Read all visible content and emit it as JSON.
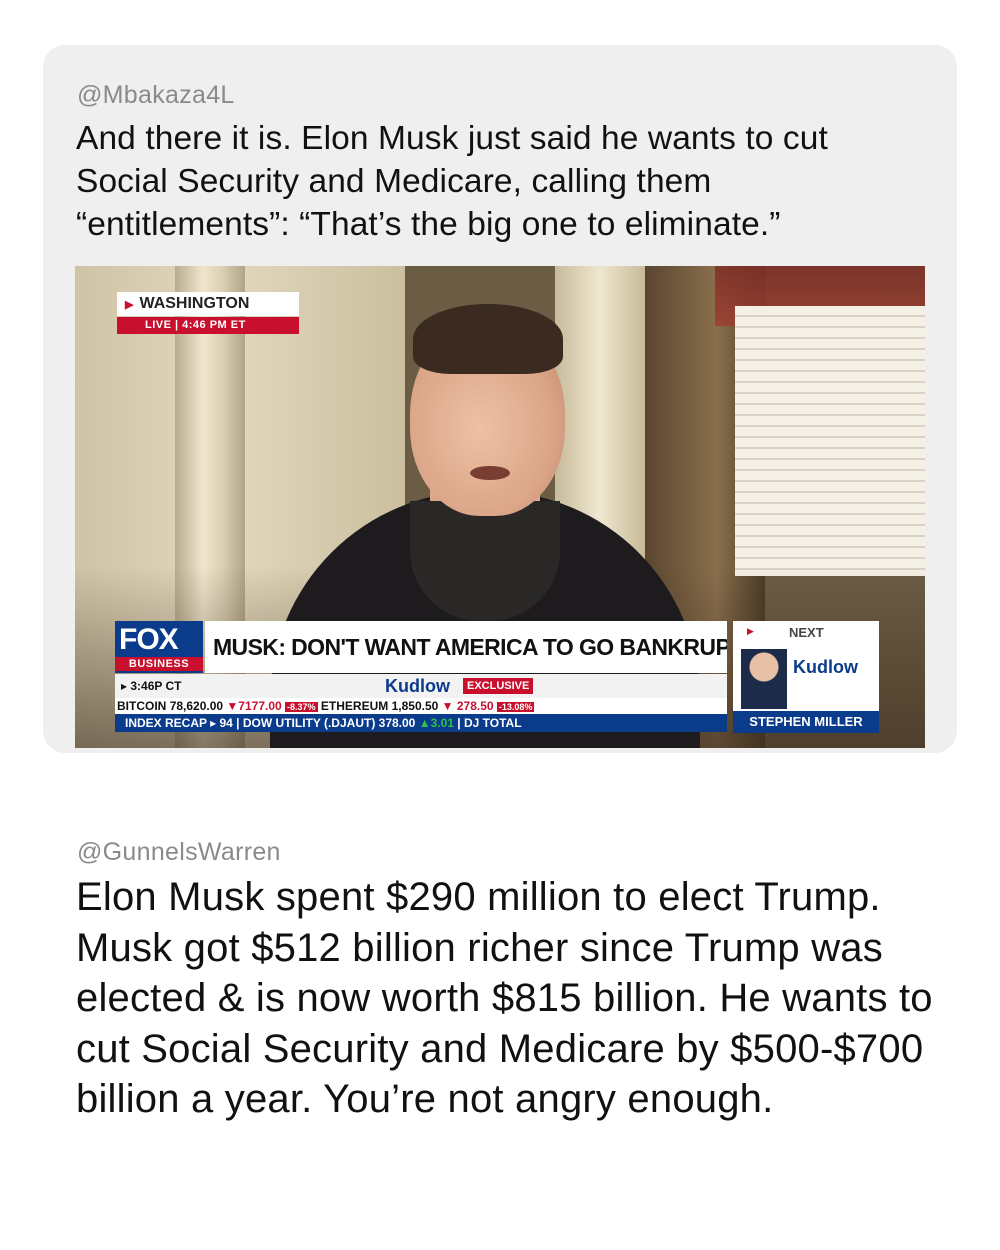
{
  "quoted_post": {
    "handle": "@Mbakaza4L",
    "text": "And there it is. Elon Musk just said he wants to cut Social Security and Medicare, calling them “entitlements”: “That’s the big one to eliminate.”",
    "video": {
      "location": "WASHINGTON",
      "live_label": "LIVE | 4:46 PM ET",
      "network_logo": "FOX",
      "network_sub": "BUSINESS",
      "headline": "MUSK: DON'T WANT AMERICA TO GO BANKRUPT",
      "time": "▸ 3:46P CT",
      "show": "Kudlow",
      "exclusive": "EXCLUSIVE",
      "ticker1": {
        "bitcoin_label": "BITCOIN",
        "bitcoin_value": "78,620.00",
        "bitcoin_change": "▼7177.00",
        "bitcoin_pct": "-8.37%",
        "eth_label": "ETHEREUM",
        "eth_value": "1,850.50",
        "eth_change": "▼ 278.50",
        "eth_pct": "-13.08%"
      },
      "ticker2": {
        "recap": "INDEX RECAP ▸ 94",
        "dow": "DOW UTILITY (.DJAUT) 378.00",
        "dow_change": "▲3.01",
        "dj_total": "DJ TOTAL"
      },
      "next_label": "NEXT",
      "next_show": "Kudlow",
      "next_guest": "STEPHEN MILLER",
      "accent_red": "#c8102e",
      "accent_blue": "#0b3c8c"
    }
  },
  "main_post": {
    "handle": "@GunnelsWarren",
    "text": "Elon Musk spent $290 million to elect Trump. Musk got $512 billion richer since Trump was elected & is now worth $815 billion. He wants to cut Social Security and Medicare by $500-$700 billion a year. You’re not angry enough."
  }
}
